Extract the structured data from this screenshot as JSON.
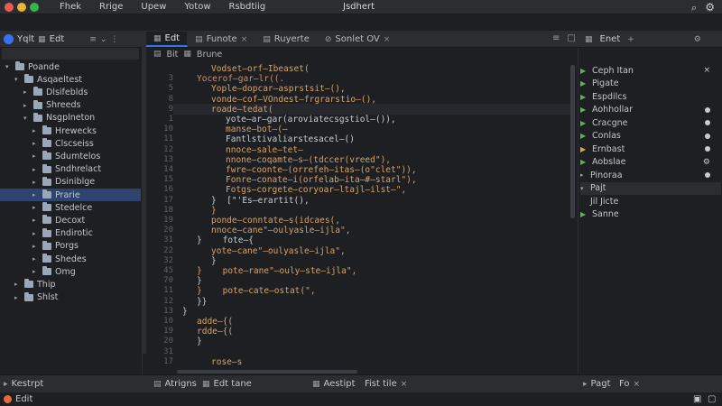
{
  "window": {
    "title": "Jsdhert"
  },
  "menu": [
    "Fhek",
    "Rrige",
    "Upew",
    "Yotow",
    "Rsbdtiig"
  ],
  "left": {
    "header": "Yqlt",
    "header2": "Edt",
    "tree": [
      {
        "label": "Poande",
        "level": 0,
        "arrow": "▾"
      },
      {
        "label": "Asqaeltest",
        "level": 1,
        "arrow": "▾"
      },
      {
        "label": "Dlsifeblds",
        "level": 2,
        "arrow": "▸"
      },
      {
        "label": "Shreeds",
        "level": 2,
        "arrow": "▸"
      },
      {
        "label": "Nsgplneton",
        "level": 2,
        "arrow": "▾"
      },
      {
        "label": "Hrewecks",
        "level": 3,
        "arrow": "▸"
      },
      {
        "label": "Clscseiss",
        "level": 3,
        "arrow": "▸"
      },
      {
        "label": "Sdumtelos",
        "level": 3,
        "arrow": "▸"
      },
      {
        "label": "Sndhrelact",
        "level": 3,
        "arrow": "▸"
      },
      {
        "label": "Dsiniblge",
        "level": 3,
        "arrow": "▸"
      },
      {
        "label": "Prarie",
        "level": 3,
        "arrow": "▸"
      },
      {
        "label": "Stedelce",
        "level": 3,
        "arrow": "▸"
      },
      {
        "label": "Decoxt",
        "level": 3,
        "arrow": "▸"
      },
      {
        "label": "Endirotic",
        "level": 3,
        "arrow": "▸"
      },
      {
        "label": "Porgs",
        "level": 3,
        "arrow": "▸"
      },
      {
        "label": "Shedes",
        "level": 3,
        "arrow": "▸"
      },
      {
        "label": "Omg",
        "level": 3,
        "arrow": "▸"
      },
      {
        "label": "Thip",
        "level": 1,
        "arrow": "▸"
      },
      {
        "label": "Shlst",
        "level": 1,
        "arrow": "▸"
      }
    ]
  },
  "editor": {
    "tabs": [
      {
        "label": "Edt",
        "active": true
      },
      {
        "label": "Funote",
        "active": false
      },
      {
        "label": "Ruyerte",
        "active": false
      },
      {
        "label": "Sonlet OV",
        "active": false
      }
    ],
    "breadcrumb": [
      "Bit",
      "Brune"
    ],
    "lines": [
      {
        "n": "",
        "text": "Vodset—orf—Ibeaset(",
        "cls": "cl-1",
        "indent": 2
      },
      {
        "n": "3",
        "text": "Yocerof—gar—lr((.",
        "cls": "cl-2",
        "indent": 1
      },
      {
        "n": "5",
        "text": "Yople—dopcar—asprstsit—(),",
        "cls": "cl-1",
        "indent": 2
      },
      {
        "n": "8",
        "text": "vonde—cof—VOndest—frgrarstio—(),",
        "cls": "cl-1",
        "indent": 2
      },
      {
        "n": "9",
        "text": "roade—tedat(",
        "cls": "cl-1",
        "indent": 2
      },
      {
        "n": "1",
        "text": "yote—ar—gar(aroviatecsgstiol—()),",
        "cls": "cl-w",
        "indent": 3
      },
      {
        "n": "10",
        "text": "manse—bot—(—",
        "cls": "cl-1",
        "indent": 3
      },
      {
        "n": "11",
        "text": "Fantlstivaliarstesacel—()",
        "cls": "cl-w",
        "indent": 3
      },
      {
        "n": "12",
        "text": "nnoce—sale—tet—",
        "cls": "cl-1",
        "indent": 3
      },
      {
        "n": "13",
        "text": "nnone—coqamte—s—(tdccer(vreed\"),",
        "cls": "cl-1",
        "indent": 3
      },
      {
        "n": "14",
        "text": "fwre—coonte—(orrefeh—itas—(o\"clet\")),",
        "cls": "cl-1",
        "indent": 3
      },
      {
        "n": "15",
        "text": "Fonre—conate—i(orfelab—ita—#—starl\"),",
        "cls": "cl-1",
        "indent": 3
      },
      {
        "n": "16",
        "text": "Fotgs—corgete—coryoar—ltajl—ilst—\",",
        "cls": "cl-1",
        "indent": 3
      },
      {
        "n": "17",
        "text": "}  [\"'Es—erartit(),",
        "cls": "cl-w",
        "indent": 2
      },
      {
        "n": "18",
        "text": "}",
        "cls": "cl-1",
        "indent": 2
      },
      {
        "n": "19",
        "text": "ponde—conntate—s(idcaes(,",
        "cls": "cl-1",
        "indent": 2
      },
      {
        "n": "20",
        "text": "nnoce—cane\"—oulyasle—ijla\",",
        "cls": "cl-1",
        "indent": 2
      },
      {
        "n": "31",
        "text": "}    fote—{",
        "cls": "cl-w",
        "indent": 1
      },
      {
        "n": "22",
        "text": "yote—cane\"—oulyasle—ijla\",",
        "cls": "cl-1",
        "indent": 2
      },
      {
        "n": "32",
        "text": "}",
        "cls": "cl-w",
        "indent": 2
      },
      {
        "n": "45",
        "text": "}    pote—rane\"—ouly—ste—ijla\",",
        "cls": "cl-1",
        "indent": 1
      },
      {
        "n": "70",
        "text": "}",
        "cls": "cl-w",
        "indent": 1
      },
      {
        "n": "11",
        "text": "}    pote—cate—ostat(\",",
        "cls": "cl-1",
        "indent": 1
      },
      {
        "n": "12",
        "text": "}}",
        "cls": "cl-w",
        "indent": 1
      },
      {
        "n": "13",
        "text": "}",
        "cls": "cl-w",
        "indent": 0
      },
      {
        "n": "10",
        "text": "adde—{(",
        "cls": "cl-1",
        "indent": 1
      },
      {
        "n": "19",
        "text": "rdde—{(",
        "cls": "cl-1",
        "indent": 1
      },
      {
        "n": "20",
        "text": "}",
        "cls": "cl-w",
        "indent": 1
      },
      {
        "n": "31",
        "text": "",
        "cls": "cl-w",
        "indent": 0
      },
      {
        "n": "17",
        "text": "rose—s",
        "cls": "cl-1",
        "indent": 2
      }
    ]
  },
  "right": {
    "header": "Enet",
    "rows": [
      {
        "label": "Ceph Itan",
        "type": "play",
        "marker": "close"
      },
      {
        "label": "Pigate",
        "type": "play",
        "marker": "none"
      },
      {
        "label": "Espdilcs",
        "type": "play",
        "marker": "none"
      },
      {
        "label": "Aohhollar",
        "type": "play",
        "marker": "dot"
      },
      {
        "label": "Cracgne",
        "type": "play",
        "marker": "dot"
      },
      {
        "label": "Conlas",
        "type": "play",
        "marker": "dot"
      },
      {
        "label": "Ernbast",
        "type": "play-y",
        "marker": "dot"
      },
      {
        "label": "Aobslae",
        "type": "play",
        "marker": "gear"
      },
      {
        "label": "Pinoraa",
        "type": "arrow",
        "marker": "dot"
      },
      {
        "label": "Pajt",
        "type": "arrow",
        "marker": "none"
      },
      {
        "label": "Jil Jicte",
        "type": "none",
        "marker": "none"
      },
      {
        "label": "Sanne",
        "type": "play",
        "marker": "none"
      }
    ]
  },
  "bottom": {
    "left": "Kestrpt",
    "tab1": "Atrigns",
    "tab2": "Edt tane",
    "tab3": "Aestipt",
    "tab4": "Fist tile",
    "right": "Pagt",
    "right2": "Fo"
  },
  "status": {
    "left": "Edit"
  }
}
